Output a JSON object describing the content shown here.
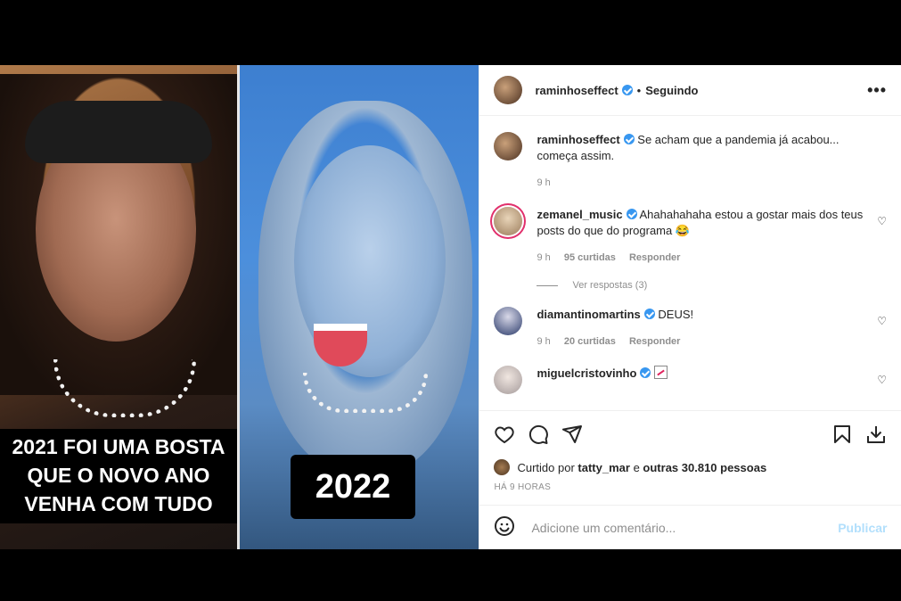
{
  "media": {
    "caption_left": "2021 FOI UMA BOSTA QUE O NOVO ANO VENHA COM TUDO",
    "caption_right": "2022"
  },
  "header": {
    "username": "raminhoseffect",
    "separator": "•",
    "follow_status": "Seguindo",
    "more": "•••"
  },
  "caption_comment": {
    "username": "raminhoseffect",
    "text": "Se acham que a pandemia já acabou... começa assim.",
    "time": "9 h"
  },
  "comments": [
    {
      "username": "zemanel_music",
      "text": "Ahahahahaha estou a gostar mais dos teus posts do que do programa 😂",
      "time": "9 h",
      "likes": "95 curtidas",
      "reply": "Responder",
      "view_replies": "Ver respostas (3)"
    },
    {
      "username": "diamantinomartins",
      "text": "DEUS!",
      "time": "9 h",
      "likes": "20 curtidas",
      "reply": "Responder"
    },
    {
      "username": "miguelcristovinho",
      "text": ""
    }
  ],
  "likes": {
    "prefix": "Curtido por",
    "user": "tatty_mar",
    "middle": "e",
    "others": "outras 30.810 pessoas"
  },
  "timestamp": "HÁ 9 HORAS",
  "add_comment": {
    "placeholder": "Adicione um comentário...",
    "publish": "Publicar"
  },
  "colors": {
    "verified": "#3897f0",
    "publish_disabled": "#b2dffc",
    "meta_gray": "#8e8e8e"
  },
  "icons": [
    "heart-icon",
    "comment-icon",
    "share-icon",
    "bookmark-icon",
    "download-icon",
    "emoji-icon",
    "verified-icon",
    "more-icon"
  ]
}
